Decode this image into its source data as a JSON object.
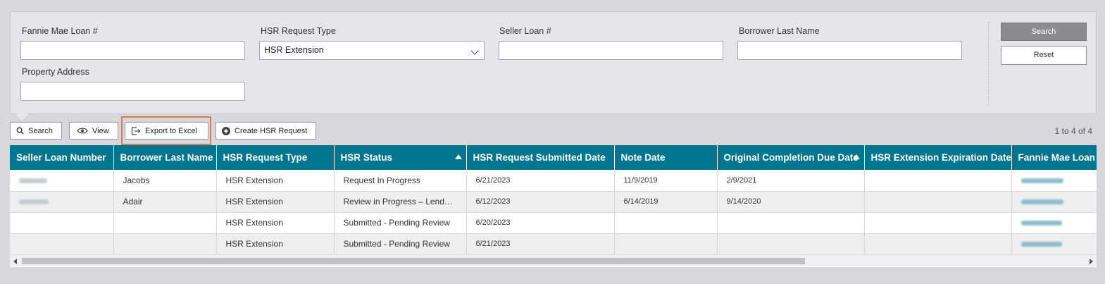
{
  "search_form": {
    "fannie_mae_loan_label": "Fannie Mae Loan #",
    "fannie_mae_loan_value": "",
    "hsr_request_type_label": "HSR Request Type",
    "hsr_request_type_value": "HSR Extension",
    "seller_loan_label": "Seller Loan #",
    "seller_loan_value": "",
    "borrower_last_name_label": "Borrower Last Name",
    "borrower_last_name_value": "",
    "property_address_label": "Property Address",
    "property_address_value": "",
    "search_button": "Search",
    "reset_button": "Reset"
  },
  "toolbar": {
    "search_label": "Search",
    "view_label": "View",
    "export_label": "Export to Excel",
    "create_label": "Create HSR Request",
    "count_text": "1 to 4 of 4"
  },
  "table": {
    "headers": [
      "Seller Loan Number",
      "Borrower Last Name",
      "HSR Request Type",
      "HSR Status",
      "HSR Request Submitted Date",
      "Note Date",
      "Original Completion Due Date",
      "HSR Extension Expiration Date",
      "Fannie Mae Loan #"
    ],
    "rows": [
      {
        "borrower": "Jacobs",
        "type": "HSR Extension",
        "status": "Request In Progress",
        "submitted": "6/21/2023",
        "note_date": "11/9/2019",
        "due_date": "2/9/2021",
        "expiration": ""
      },
      {
        "borrower": "Adair",
        "type": "HSR Extension",
        "status": "Review in Progress – Lender Action Required",
        "submitted": "6/12/2023",
        "note_date": "6/14/2019",
        "due_date": "9/14/2020",
        "expiration": ""
      },
      {
        "borrower": "",
        "type": "HSR Extension",
        "status": "Submitted - Pending Review",
        "submitted": "6/20/2023",
        "note_date": "",
        "due_date": "",
        "expiration": ""
      },
      {
        "borrower": "",
        "type": "HSR Extension",
        "status": "Submitted - Pending Review",
        "submitted": "6/21/2023",
        "note_date": "",
        "due_date": "",
        "expiration": ""
      }
    ]
  },
  "colors": {
    "header_bg": "#00758f",
    "highlight": "#d97c53",
    "panel_bg": "#e6e5e9",
    "page_bg": "#d8d7dc"
  }
}
